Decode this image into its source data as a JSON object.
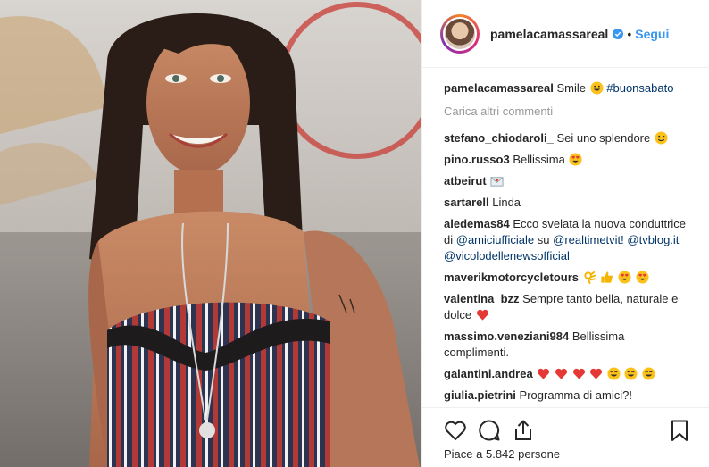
{
  "header": {
    "username": "pamelacamassareal",
    "dot": "•",
    "follow_label": "Segui"
  },
  "caption": {
    "username": "pamelacamassareal",
    "text": "Smile",
    "hashtag": "#buonsabato"
  },
  "load_more": "Carica altri commenti",
  "comments": [
    {
      "user": "stefano_chiodaroli_",
      "text": "Sei uno splendore",
      "emoji": [
        "wink"
      ]
    },
    {
      "user": "pino.russo3",
      "text": "Bellissima",
      "emoji": [
        "heart-eyes"
      ]
    },
    {
      "user": "atbeirut",
      "text": "",
      "emoji": [
        "love-letter"
      ]
    },
    {
      "user": "sartarell",
      "text": "Linda",
      "emoji": []
    },
    {
      "user": "aledemas84",
      "text": "Ecco svelata la nuova conduttrice di",
      "mention1": "@amiciufficiale",
      "text2": "su",
      "mention2": "@realtimetvit!",
      "mention3": "@tvblog.it",
      "mention4": "@vicolodellenewsofficial"
    },
    {
      "user": "maverikmotorcycletours",
      "text": "",
      "emoji": [
        "ok-hand",
        "thumbs-up",
        "heart-eyes",
        "heart-eyes"
      ]
    },
    {
      "user": "valentina_bzz",
      "text": "Sempre tanto bella, naturale e dolce",
      "emoji": [
        "red-heart"
      ]
    },
    {
      "user": "massimo.veneziani984",
      "text": "Bellissima complimenti.",
      "emoji": []
    },
    {
      "user": "galantini.andrea",
      "text": "",
      "emoji": [
        "red-heart",
        "red-heart",
        "red-heart",
        "red-heart",
        "grin",
        "grin",
        "grin"
      ]
    },
    {
      "user": "giulia.pietrini",
      "text": "Programma di amici?!"
    }
  ],
  "likes_text": "Piace a 5.842 persone",
  "colors": {
    "accent": "#3897f0",
    "link": "#003569",
    "muted": "#999999",
    "text": "#262626"
  },
  "icons": [
    "verified-badge-icon",
    "heart-icon",
    "comment-icon",
    "share-icon",
    "bookmark-icon"
  ]
}
